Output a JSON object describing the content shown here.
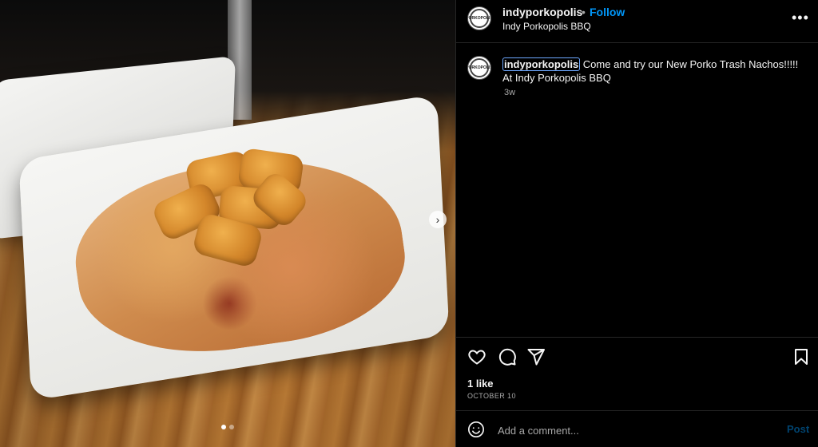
{
  "post": {
    "username": "indyporkopolis",
    "separator": "•",
    "follow_label": "Follow",
    "location": "Indy Porkopolis BBQ",
    "more_label": "•••",
    "avatar_text": "PORKOPOLIS"
  },
  "caption": {
    "username": "indyporkopolis",
    "text": "Come and try our New Porko Trash Nachos!!!!! At Indy Porkopolis BBQ",
    "time_ago": "3w"
  },
  "media": {
    "slide_count": 2,
    "active_slide": 1,
    "next_label": "›"
  },
  "actions": {
    "icons": [
      "heart-icon",
      "comment-icon",
      "share-icon",
      "bookmark-icon"
    ]
  },
  "stats": {
    "likes": "1 like",
    "date": "OCTOBER 10"
  },
  "comment": {
    "placeholder": "Add a comment...",
    "post_label": "Post"
  },
  "colors": {
    "background": "#000000",
    "text": "#f5f5f5",
    "secondary_text": "#a8a8a8",
    "accent": "#0095f6",
    "divider": "#262626"
  }
}
